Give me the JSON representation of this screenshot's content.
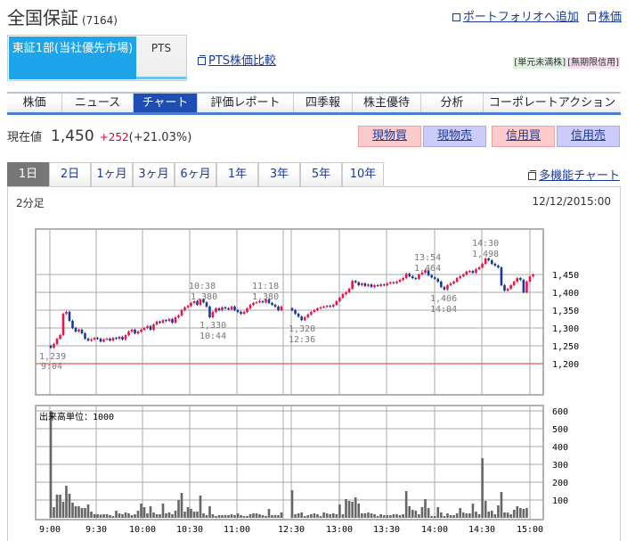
{
  "header": {
    "company": "全国保証",
    "code": "(7164)",
    "portfolio_link": "ポートフォリオへ追加",
    "stock_link": "株価"
  },
  "market_tabs": [
    {
      "label": "東証1部(当社優先市場)",
      "active": true
    },
    {
      "label": "PTS",
      "active": false
    }
  ],
  "pts_compare_link": "PTS株価比較",
  "badges": [
    "[単元未満株]",
    "[無期限信用]"
  ],
  "nav_tabs": [
    {
      "label": "株価"
    },
    {
      "label": "ニュース"
    },
    {
      "label": "チャート",
      "active": true
    },
    {
      "label": "評価レポート"
    },
    {
      "label": "四季報"
    },
    {
      "label": "株主優待"
    },
    {
      "label": "分析"
    },
    {
      "label": "コーポレートアクション"
    }
  ],
  "quote": {
    "label": "現在値",
    "price": "1,450",
    "change": "+252",
    "change_pct": "(+21.03%)"
  },
  "trade_buttons": {
    "cash_buy": "現物買",
    "cash_sell": "現物売",
    "margin_buy": "信用買",
    "margin_sell": "信用売"
  },
  "period_tabs": [
    {
      "label": "1日",
      "active": true
    },
    {
      "label": "2日"
    },
    {
      "label": "1ヶ月"
    },
    {
      "label": "3ヶ月"
    },
    {
      "label": "6ヶ月"
    },
    {
      "label": "1年"
    },
    {
      "label": "3年"
    },
    {
      "label": "5年"
    },
    {
      "label": "10年"
    }
  ],
  "multi_chart_link": "多機能チャート",
  "chart": {
    "interval": "2分足",
    "datetime": "12/12/2015:00"
  },
  "chart_data": {
    "type": "candlestick",
    "price_ticks": [
      "1,450",
      "1,400",
      "1,350",
      "1,300",
      "1,250",
      "1,200"
    ],
    "price_tick_values": [
      1450,
      1400,
      1350,
      1300,
      1250,
      1200
    ],
    "prev_close": 1198,
    "volume_unit_label": "出来高単位：1000",
    "volume_ticks": [
      "600",
      "500",
      "400",
      "300",
      "200",
      "100"
    ],
    "volume_tick_values": [
      600,
      500,
      400,
      300,
      200,
      100
    ],
    "time_ticks": [
      "9:00",
      "9:30",
      "10:00",
      "10:30",
      "11:00",
      "12:30",
      "13:00",
      "13:30",
      "14:00",
      "14:30",
      "15:00"
    ],
    "annotations": [
      {
        "time": "9:04",
        "price": "1,239"
      },
      {
        "time": "10:38",
        "price": "1,380"
      },
      {
        "time": "10:44",
        "price": "1,330"
      },
      {
        "time": "11:18",
        "price": "1,380"
      },
      {
        "time": "12:36",
        "price": "1,320"
      },
      {
        "time": "13:54",
        "price": "1,464"
      },
      {
        "time": "14:04",
        "price": "1,406"
      },
      {
        "time": "14:30",
        "price": "1,498"
      }
    ],
    "morning_open": 1250,
    "morning_close": [
      1245,
      1255,
      1270,
      1280,
      1340,
      1345,
      1320,
      1300,
      1290,
      1295,
      1285,
      1270,
      1265,
      1268,
      1272,
      1270,
      1262,
      1268,
      1270,
      1265,
      1272,
      1270,
      1275,
      1268,
      1280,
      1290,
      1295,
      1285,
      1290,
      1295,
      1300,
      1305,
      1295,
      1310,
      1318,
      1315,
      1322,
      1320,
      1325,
      1315,
      1330,
      1335,
      1350,
      1358,
      1362,
      1370,
      1375,
      1365,
      1380,
      1372,
      1360,
      1330,
      1345,
      1355,
      1350,
      1358,
      1355,
      1352,
      1360,
      1350,
      1345,
      1340,
      1345,
      1355,
      1365,
      1370,
      1372,
      1375,
      1372,
      1380,
      1370,
      1365,
      1360,
      1350,
      1360
    ],
    "afternoon_open": 1355,
    "afternoon_close": [
      1350,
      1340,
      1332,
      1322,
      1330,
      1338,
      1345,
      1350,
      1355,
      1358,
      1360,
      1362,
      1360,
      1365,
      1375,
      1385,
      1395,
      1400,
      1410,
      1432,
      1428,
      1420,
      1425,
      1418,
      1422,
      1415,
      1420,
      1418,
      1422,
      1420,
      1425,
      1428,
      1426,
      1430,
      1435,
      1440,
      1452,
      1445,
      1440,
      1438,
      1450,
      1455,
      1462,
      1448,
      1442,
      1438,
      1430,
      1415,
      1408,
      1420,
      1425,
      1430,
      1440,
      1445,
      1450,
      1458,
      1460,
      1455,
      1465,
      1470,
      1480,
      1495,
      1490,
      1480,
      1475,
      1470,
      1420,
      1405,
      1410,
      1420,
      1430,
      1440,
      1435,
      1400,
      1430,
      1445,
      1450
    ],
    "morning_volume": [
      600,
      60,
      130,
      130,
      90,
      180,
      135,
      85,
      65,
      65,
      55,
      55,
      75,
      35,
      20,
      20,
      18,
      20,
      20,
      15,
      10,
      40,
      25,
      20,
      30,
      25,
      15,
      20,
      40,
      80,
      60,
      25,
      65,
      30,
      20,
      20,
      80,
      25,
      30,
      20,
      40,
      100,
      140,
      35,
      60,
      50,
      35,
      35,
      125,
      25,
      15,
      65,
      20,
      10,
      15,
      15,
      15,
      15,
      20,
      15,
      25,
      15,
      10,
      10,
      20,
      25,
      25,
      20,
      15,
      10,
      50,
      15,
      15,
      15,
      30
    ],
    "afternoon_volume": [
      155,
      20,
      25,
      30,
      10,
      15,
      20,
      25,
      20,
      10,
      30,
      25,
      20,
      25,
      20,
      75,
      20,
      105,
      95,
      90,
      115,
      80,
      25,
      25,
      30,
      25,
      20,
      10,
      20,
      15,
      15,
      15,
      20,
      20,
      15,
      20,
      150,
      65,
      45,
      40,
      20,
      60,
      105,
      55,
      10,
      10,
      60,
      30,
      10,
      25,
      15,
      15,
      25,
      55,
      30,
      25,
      25,
      80,
      35,
      20,
      335,
      95,
      35,
      40,
      20,
      70,
      145,
      30,
      30,
      20,
      45,
      65,
      55,
      50,
      55
    ],
    "colors": {
      "up": "#e8174a",
      "down": "#1a3a9a",
      "volume": "#666666",
      "prev_close_line": "#f07070"
    }
  }
}
